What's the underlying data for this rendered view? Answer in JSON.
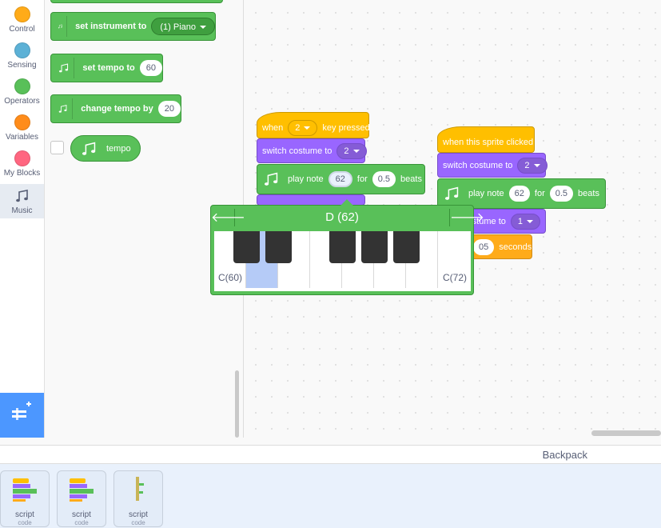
{
  "categories": [
    {
      "label": "Control",
      "color": "#ffab19"
    },
    {
      "label": "Sensing",
      "color": "#5cb1d6"
    },
    {
      "label": "Operators",
      "color": "#59c059"
    },
    {
      "label": "Variables",
      "color": "#ff8c1a"
    },
    {
      "label": "My Blocks",
      "color": "#ff6680"
    },
    {
      "label": "Music",
      "color": "#4c97ff"
    }
  ],
  "palette": {
    "set_instrument": {
      "label": "set instrument to",
      "value": "(1) Piano"
    },
    "set_tempo": {
      "label": "set tempo to",
      "value": "60"
    },
    "change_tempo": {
      "label": "change tempo by",
      "value": "20"
    },
    "tempo_reporter": {
      "label": "tempo"
    }
  },
  "script1": {
    "hat": {
      "pre": "when",
      "key": "2",
      "post": "key pressed"
    },
    "costume": {
      "label": "switch costume to",
      "value": "2"
    },
    "note": {
      "label": "play note",
      "note": "62",
      "for": "for",
      "beats": "0.5",
      "unit": "beats"
    }
  },
  "script2": {
    "hat": {
      "label": "when this sprite clicked"
    },
    "costume": {
      "label": "switch costume to",
      "value": "2"
    },
    "note": {
      "label": "play note",
      "note": "62",
      "for": "for",
      "beats": "0.5",
      "unit": "beats"
    },
    "costume2": {
      "label": "costume to",
      "value": "1"
    },
    "wait": {
      "value": "05",
      "unit": "seconds"
    }
  },
  "piano": {
    "title": "D (62)",
    "low_label": "C(60)",
    "high_label": "C(72)",
    "left_arrow": "🡐",
    "right_arrow": "🡒"
  },
  "backpack": {
    "label": "Backpack",
    "items": [
      {
        "title": "script",
        "sub": "code"
      },
      {
        "title": "script",
        "sub": "code"
      },
      {
        "title": "script",
        "sub": "code"
      }
    ]
  }
}
